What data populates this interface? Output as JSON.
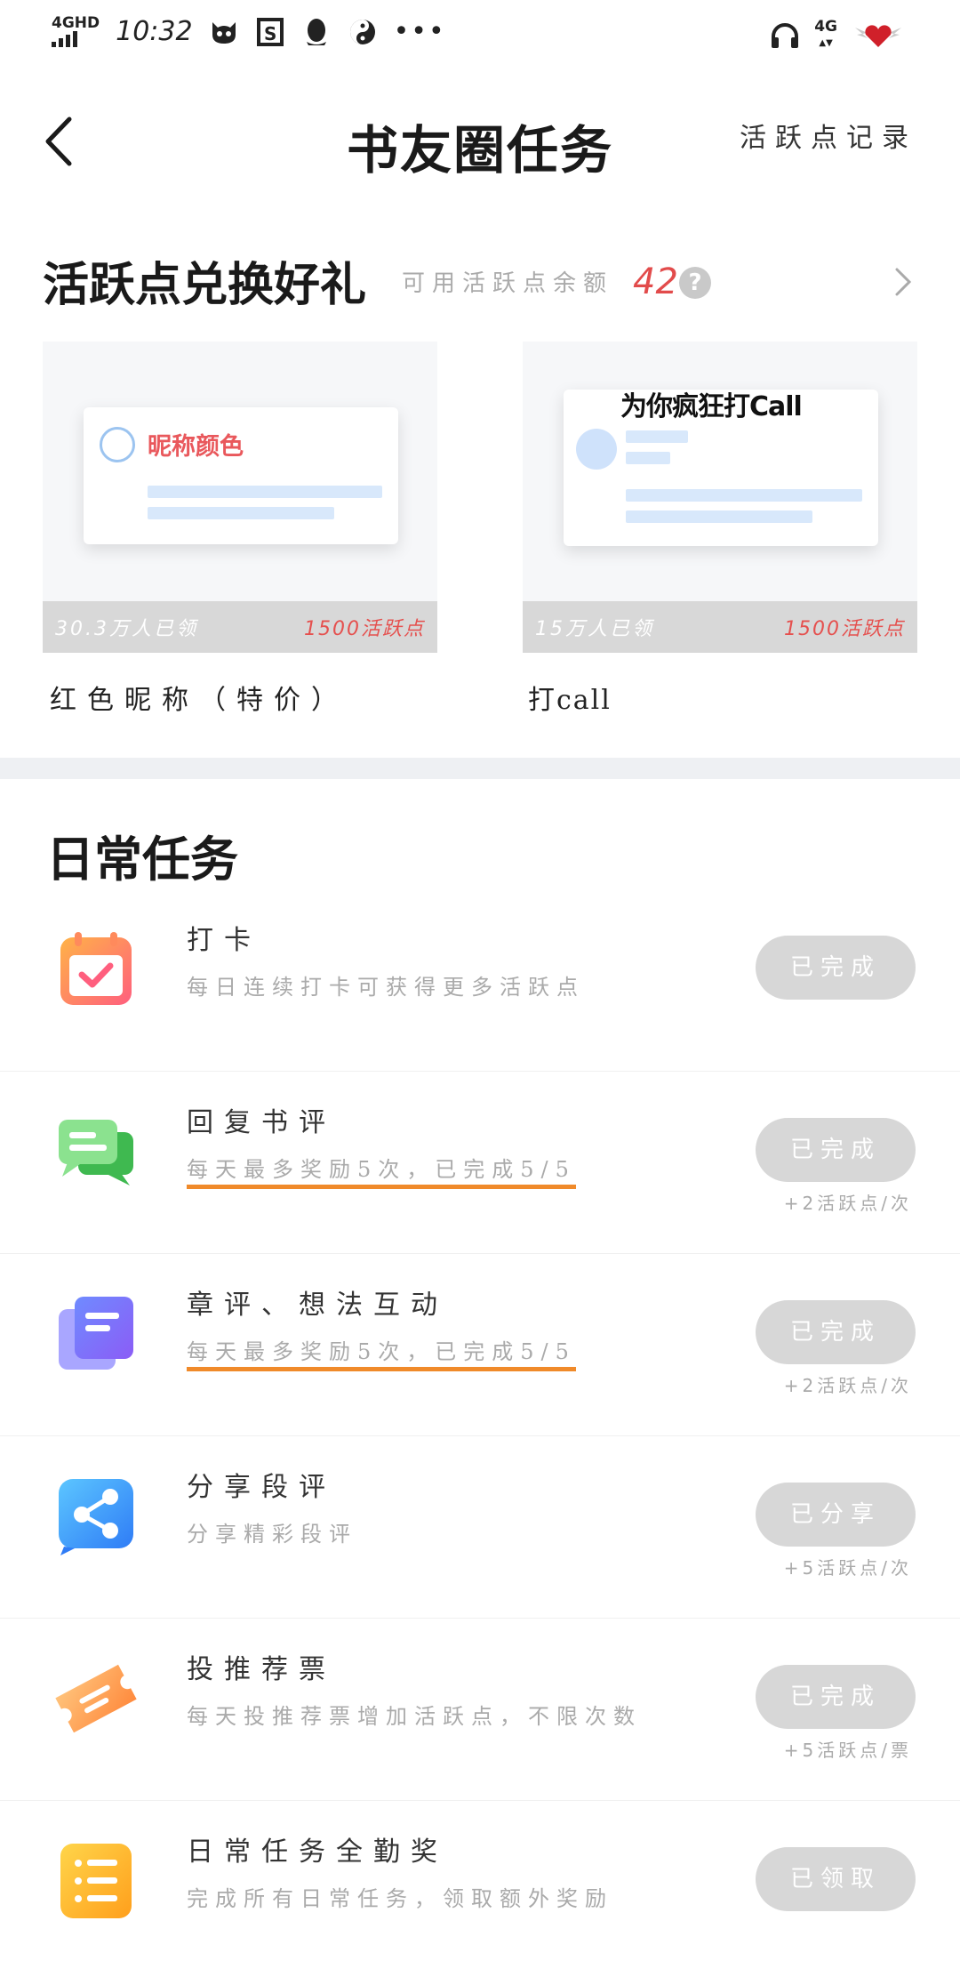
{
  "statusbar": {
    "network": "4GHD",
    "time": "10:32",
    "icons": [
      "cat-face-icon",
      "sim-card-icon",
      "qq-penguin-icon",
      "yin-yang-icon"
    ],
    "more": "•••",
    "right_network": "4G",
    "right_icons": [
      "headphones-icon",
      "heart-wings-battery-icon"
    ]
  },
  "header": {
    "title": "书友圈任务",
    "record_link": "活跃点记录"
  },
  "exchange": {
    "title": "活跃点兑换好礼",
    "balance_label": "可用活跃点余额",
    "balance_value": "42",
    "help": "?",
    "cards": [
      {
        "preview_label": "昵称颜色",
        "redeemed": "30.3万人已领",
        "cost": "1500活跃点",
        "name": "红色昵称（特价）"
      },
      {
        "preview_label": "为你疯狂打Call",
        "redeemed": "15万人已领",
        "cost": "1500活跃点",
        "name": "打call"
      }
    ]
  },
  "daily": {
    "title": "日常任务",
    "tasks": [
      {
        "icon": "calendar-check-icon",
        "name": "打卡",
        "desc": "每日连续打卡可获得更多活跃点",
        "button": "已完成",
        "reward": ""
      },
      {
        "icon": "chat-bubbles-icon",
        "name": "回复书评",
        "desc": "每天最多奖励5次，已完成5/5",
        "button": "已完成",
        "reward": "+2活跃点/次"
      },
      {
        "icon": "stacked-notes-icon",
        "name": "章评、想法互动",
        "desc": "每天最多奖励5次，已完成5/5",
        "button": "已完成",
        "reward": "+2活跃点/次"
      },
      {
        "icon": "share-icon",
        "name": "分享段评",
        "desc": "分享精彩段评",
        "button": "已分享",
        "reward": "+5活跃点/次"
      },
      {
        "icon": "ticket-icon",
        "name": "投推荐票",
        "desc": "每天投推荐票增加活跃点，不限次数",
        "button": "已完成",
        "reward": "+5活跃点/票"
      },
      {
        "icon": "list-icon",
        "name": "日常任务全勤奖",
        "desc": "完成所有日常任务，领取额外奖励",
        "button": "已领取",
        "reward": ""
      }
    ]
  },
  "colors": {
    "accent_red": "#e5504e",
    "progress_underline": "#f08a2a",
    "button_done": "#d7d7d7"
  }
}
